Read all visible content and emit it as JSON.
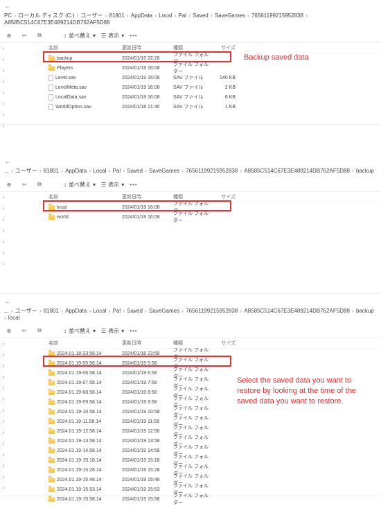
{
  "labels": {
    "sort": "並べ替え",
    "view": "表示",
    "col_name": "名前",
    "col_date": "更新日時",
    "col_type": "種類",
    "col_size": "サイズ",
    "type_folder": "ファイル フォルダー",
    "type_sav": "SAV ファイル"
  },
  "annotations": {
    "a1": "Backup saved data",
    "a2": "Select the saved data you want to restore by looking at the time of the saved data you want to restore."
  },
  "sec1": {
    "breadcrumb": [
      "PC",
      "ローカル ディスク (C:)",
      "ユーザー",
      "81801",
      "AppData",
      "Local",
      "Pal",
      "Saved",
      "SaveGames",
      "76561199215952838",
      "A8585C514C67E3E489214DB762AF5D88"
    ],
    "rows": [
      {
        "name": "backup",
        "date": "2024/01/19 22:28",
        "type": "folder",
        "size": ""
      },
      {
        "name": "Players",
        "date": "2024/01/19 16:08",
        "type": "folder",
        "size": ""
      },
      {
        "name": "Level.sav",
        "date": "2024/01/19 16:08",
        "type": "sav",
        "size": "140 KB"
      },
      {
        "name": "LevelMeta.sav",
        "date": "2024/01/19 16:08",
        "type": "sav",
        "size": "2 KB"
      },
      {
        "name": "LocalData.sav",
        "date": "2024/01/19 16:08",
        "type": "sav",
        "size": "6 KB"
      },
      {
        "name": "WorldOption.sav",
        "date": "2024/01/18 21:40",
        "type": "sav",
        "size": "1 KB"
      }
    ]
  },
  "sec2": {
    "breadcrumb": [
      "...",
      "ユーザー",
      "81801",
      "AppData",
      "Local",
      "Pal",
      "Saved",
      "SaveGames",
      "76561199215952838",
      "A8585C514C67E3E489214DB762AF5D88",
      "backup"
    ],
    "rows": [
      {
        "name": "local",
        "date": "2024/01/19 16:08",
        "type": "folder",
        "size": ""
      },
      {
        "name": "world",
        "date": "2024/01/19 16:08",
        "type": "folder",
        "size": ""
      }
    ]
  },
  "sec3": {
    "breadcrumb": [
      "...",
      "ユーザー",
      "81801",
      "AppData",
      "Local",
      "Pal",
      "Saved",
      "SaveGames",
      "76561199215952838",
      "A8585C514C67E3E489214DB762AF5D88",
      "backup",
      "local"
    ],
    "rows": [
      {
        "name": "2024.01.18-23.58.14",
        "date": "2024/01/18 23:58",
        "type": "folder",
        "size": ""
      },
      {
        "name": "2024.01.19-05.58.14",
        "date": "2024/01/19 5:58",
        "type": "folder",
        "size": ""
      },
      {
        "name": "2024.01.19-06.58.14",
        "date": "2024/01/19 6:58",
        "type": "folder",
        "size": ""
      },
      {
        "name": "2024.01.19-07.58.14",
        "date": "2024/01/19 7:58",
        "type": "folder",
        "size": ""
      },
      {
        "name": "2024.01.19-08.58.14",
        "date": "2024/01/19 8:58",
        "type": "folder",
        "size": ""
      },
      {
        "name": "2024.01.19-09.58.14",
        "date": "2024/01/19 9:58",
        "type": "folder",
        "size": ""
      },
      {
        "name": "2024.01.19-10.58.14",
        "date": "2024/01/19 10:58",
        "type": "folder",
        "size": ""
      },
      {
        "name": "2024.01.19-11.58.14",
        "date": "2024/01/19 11:58",
        "type": "folder",
        "size": ""
      },
      {
        "name": "2024.01.19-12.58.14",
        "date": "2024/01/19 12:58",
        "type": "folder",
        "size": ""
      },
      {
        "name": "2024.01.19-13.58.14",
        "date": "2024/01/19 13:58",
        "type": "folder",
        "size": ""
      },
      {
        "name": "2024.01.19-14.58.14",
        "date": "2024/01/19 14:58",
        "type": "folder",
        "size": ""
      },
      {
        "name": "2024.01.19-15.18.14",
        "date": "2024/01/19 15:18",
        "type": "folder",
        "size": ""
      },
      {
        "name": "2024.01.19-15.28.14",
        "date": "2024/01/19 15:28",
        "type": "folder",
        "size": ""
      },
      {
        "name": "2024.01.19-15.48.14",
        "date": "2024/01/19 15:48",
        "type": "folder",
        "size": ""
      },
      {
        "name": "2024.01.19-15.53.14",
        "date": "2024/01/19 15:53",
        "type": "folder",
        "size": ""
      },
      {
        "name": "2024.01.19-15.58.14",
        "date": "2024/01/19 15:58",
        "type": "folder",
        "size": ""
      }
    ]
  }
}
